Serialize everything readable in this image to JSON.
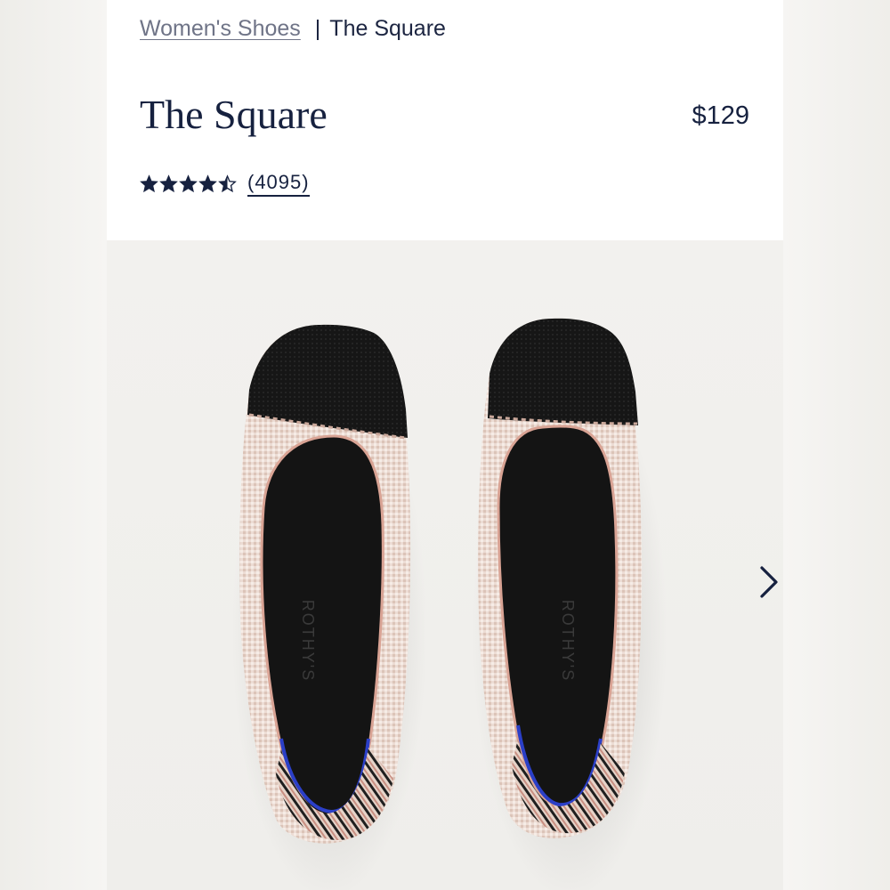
{
  "breadcrumb": {
    "parent": "Women's Shoes",
    "separator": "|",
    "current": "The Square"
  },
  "product": {
    "title": "The Square",
    "price": "$129",
    "rating": 4.5,
    "rating_max": 5,
    "review_count": "(4095)",
    "insole_brand": "ROTHY'S"
  },
  "icons": {
    "stars": "star-icon",
    "next": "chevron-right-icon"
  },
  "colors": {
    "text_primary": "#16213f",
    "link_muted": "#6f7487",
    "shoe_black": "#141414",
    "shoe_blush": "#ead9d1",
    "heel_accent": "#2b3fc7"
  }
}
